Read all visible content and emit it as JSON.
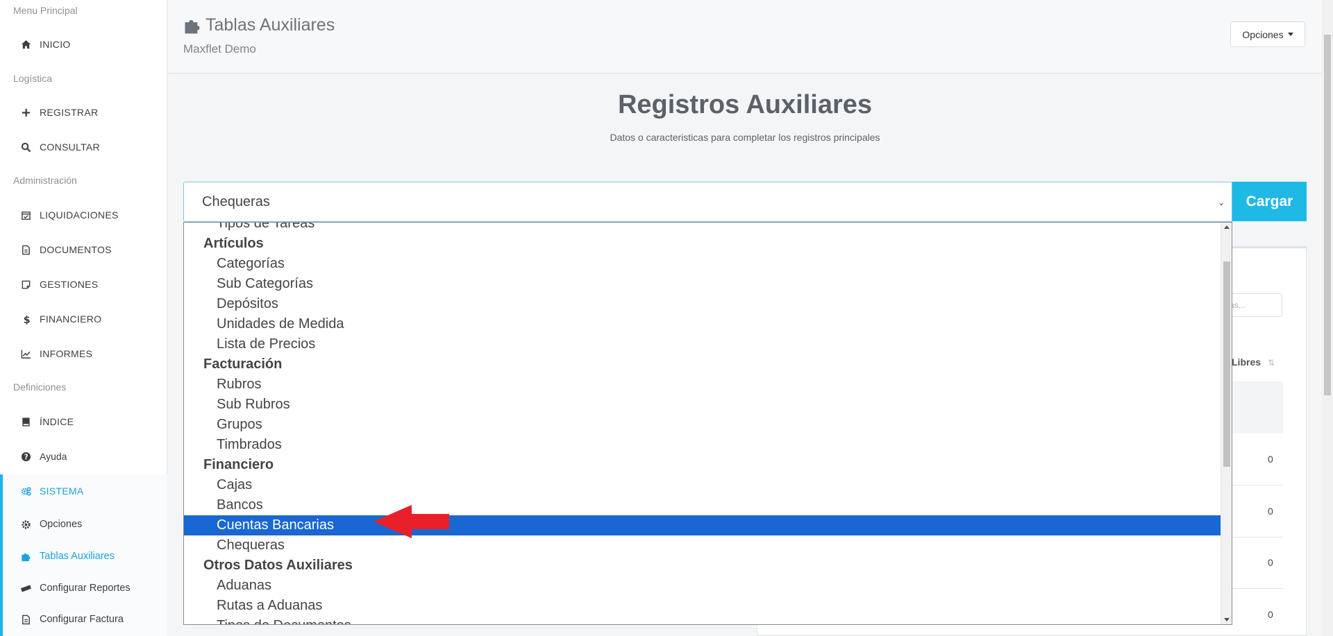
{
  "sidebar": {
    "sections": {
      "menu": "Menu Principal",
      "logistica": "Logística",
      "admin": "Administración",
      "defs": "Definiciones"
    },
    "items": {
      "inicio": "INICIO",
      "registrar": "REGISTRAR",
      "consultar": "CONSULTAR",
      "liquidaciones": "LIQUIDACIONES",
      "documentos": "DOCUMENTOS",
      "gestiones": "GESTIONES",
      "financiero": "FINANCIERO",
      "informes": "INFORMES",
      "indice": "ÍNDICE",
      "ayuda": "Ayuda",
      "sistema": "SISTEMA",
      "opciones": "Opciones",
      "tablas": "Tablas Auxiliares",
      "reportes": "Configurar Reportes",
      "factura": "Configurar Factura"
    }
  },
  "header": {
    "title": "Tablas Auxiliares",
    "subtitle": "Maxflet Demo",
    "options_label": "Opciones"
  },
  "main": {
    "title": "Registros Auxiliares",
    "subtitle": "Datos o caracteristicas para completar los registros principales",
    "select_value": "Chequeras",
    "load_button": "Cargar"
  },
  "dropdown": {
    "partial_top": "Tipos de Tareas",
    "groups": [
      {
        "label": "Artículos",
        "options": [
          "Categorías",
          "Sub Categorías",
          "Depósitos",
          "Unidades de Medida",
          "Lista de Precios"
        ]
      },
      {
        "label": "Facturación",
        "options": [
          "Rubros",
          "Sub Rubros",
          "Grupos",
          "Timbrados"
        ]
      },
      {
        "label": "Financiero",
        "options": [
          "Cajas",
          "Bancos",
          "Cuentas Bancarias",
          "Chequeras"
        ]
      },
      {
        "label": "Otros Datos Auxiliares",
        "options": [
          "Aduanas",
          "Rutas a Aduanas",
          "Tipos de Documentos"
        ]
      }
    ],
    "selected": "Cuentas Bancarias"
  },
  "card": {
    "search_placeholder": "as...",
    "column_header": "Libres",
    "cells": [
      "0",
      "0",
      "0",
      "0"
    ]
  },
  "annotation": {
    "arrow_color": "#e8202a"
  }
}
